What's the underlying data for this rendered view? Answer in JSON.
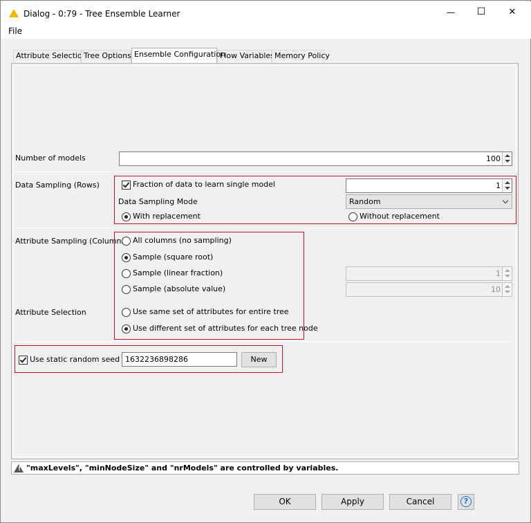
{
  "window": {
    "title": "Dialog - 0:79 - Tree Ensemble Learner",
    "minimize_glyph": "—",
    "maximize_glyph": "☐",
    "close_glyph": "✕"
  },
  "menu": {
    "file": "File"
  },
  "tabs": [
    {
      "label": "Attribute Selection"
    },
    {
      "label": "Tree Options"
    },
    {
      "label": "Ensemble Configuration"
    },
    {
      "label": "Flow Variables"
    },
    {
      "label": "Memory Policy"
    }
  ],
  "number_of_models": {
    "label": "Number of models",
    "value": "100"
  },
  "data_sampling": {
    "section_label": "Data Sampling (Rows)",
    "fraction_label": "Fraction of data to learn single model",
    "fraction_checked": true,
    "fraction_value": "1",
    "mode_label": "Data Sampling Mode",
    "mode_value": "Random",
    "with_replacement": "With replacement",
    "without_replacement": "Without replacement",
    "selected": "with_replacement"
  },
  "attribute_sampling": {
    "section_label": "Attribute Sampling (Columns)",
    "all_columns": "All columns (no sampling)",
    "square_root": "Sample (square root)",
    "linear_fraction": "Sample (linear fraction)",
    "linear_fraction_value": "1",
    "absolute_value": "Sample (absolute value)",
    "absolute_value_value": "10",
    "selected": "square_root"
  },
  "attribute_selection": {
    "section_label": "Attribute Selection",
    "same_set": "Use same set of attributes for entire tree",
    "different_set": "Use different set of attributes for each tree node",
    "selected": "different_set"
  },
  "random_seed": {
    "label": "Use static random seed",
    "checked": true,
    "value": "1632236898286",
    "new_button": "New"
  },
  "status_message": "\"maxLevels\", \"minNodeSize\" and \"nrModels\" are controlled by variables.",
  "buttons": {
    "ok": "OK",
    "apply": "Apply",
    "cancel": "Cancel",
    "help": "?"
  },
  "colors": {
    "highlight_box": "#c8102e",
    "help_accent": "#1e6fd9",
    "app_icon": "#f2b800"
  }
}
